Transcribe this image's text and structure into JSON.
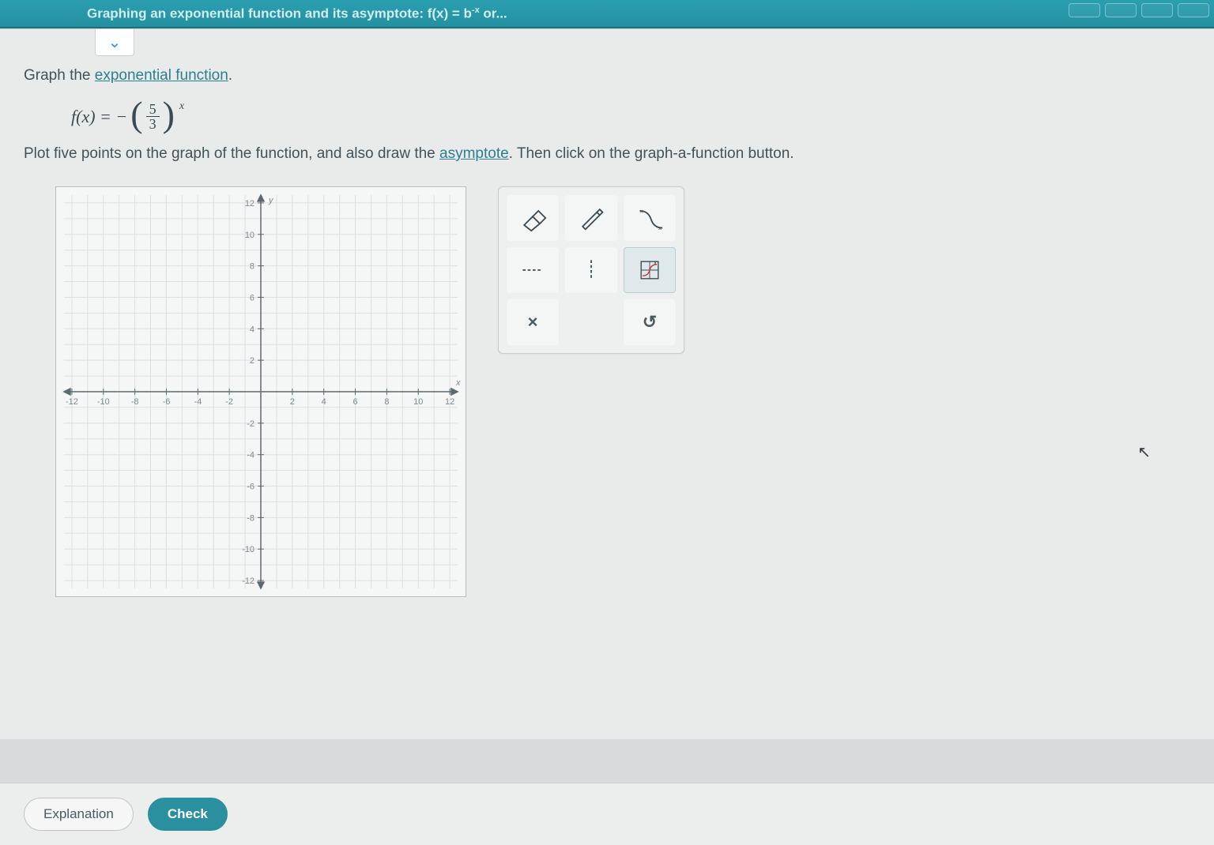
{
  "header": {
    "title_prefix": "Graphing an exponential function and its asymptote: f(x) = b",
    "title_exp": "-x",
    "title_suffix": " or..."
  },
  "prompt": {
    "pre": "Graph the ",
    "link": "exponential function",
    "post": "."
  },
  "formula": {
    "lhs": "f(x) = −",
    "num": "5",
    "den": "3",
    "exp": "x"
  },
  "instruction": {
    "part1": "Plot five points on the graph of the function, and also draw the ",
    "link": "asymptote",
    "part2": ". Then click on the graph-a-function button."
  },
  "graph": {
    "x_axis_label": "x",
    "y_axis_label": "y",
    "x_ticks": [
      "-12",
      "-10",
      "-8",
      "-6",
      "-4",
      "-2",
      "2",
      "4",
      "6",
      "8",
      "10",
      "12"
    ],
    "y_ticks_pos": [
      "2",
      "4",
      "6",
      "8",
      "10",
      "12"
    ],
    "y_ticks_neg": [
      "-2",
      "-4",
      "-6",
      "-8",
      "-10",
      "-12"
    ]
  },
  "tools": {
    "eraser": "eraser-icon",
    "pencil": "pencil-icon",
    "curve": "curve-icon",
    "hasym": "horizontal-asymptote-icon",
    "vasym": "vertical-asymptote-icon",
    "plotfn": "graph-function-icon",
    "clear_label": "×",
    "undo_label": "↺"
  },
  "buttons": {
    "explanation": "Explanation",
    "check": "Check"
  }
}
